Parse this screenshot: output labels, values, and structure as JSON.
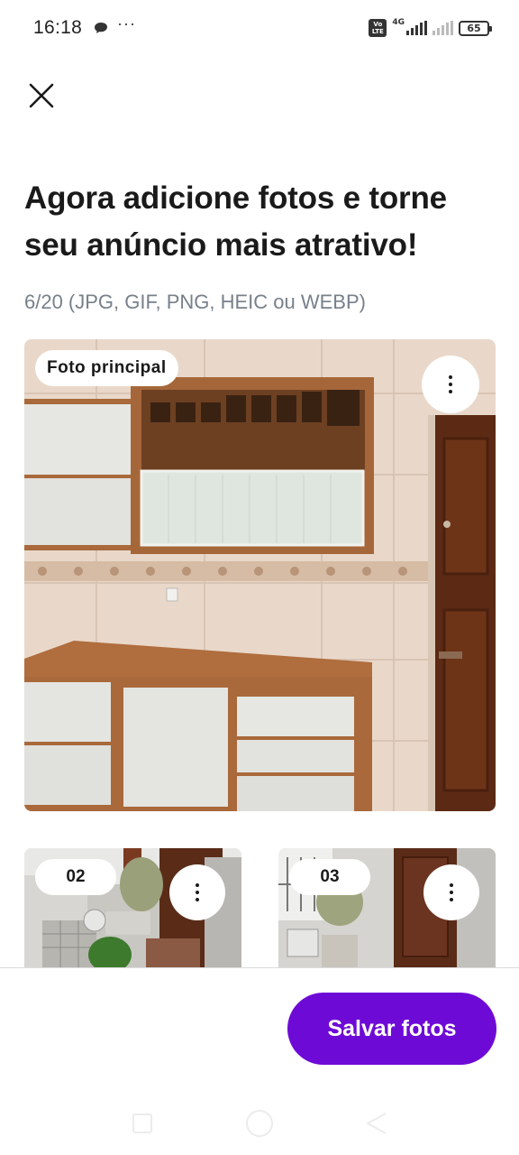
{
  "status_bar": {
    "time": "16:18",
    "more_dots": "···",
    "network_tag": "4G",
    "volte_label": "Vo LTE",
    "battery_level": "65"
  },
  "header": {
    "title": "Agora adicione fotos e torne seu anúncio mais atrativo!",
    "subtitle": "6/20 (JPG, GIF, PNG, HEIC ou WEBP)"
  },
  "photos": [
    {
      "badge": "Foto principal"
    },
    {
      "badge": "02"
    },
    {
      "badge": "03"
    }
  ],
  "footer": {
    "save_label": "Salvar fotos"
  },
  "colors": {
    "primary": "#6e0ad6",
    "text": "#1a1a1a",
    "muted": "#77808a"
  }
}
